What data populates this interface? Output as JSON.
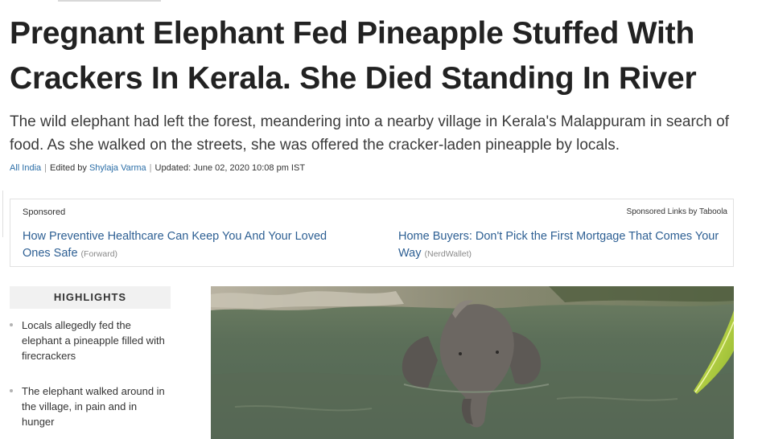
{
  "article": {
    "headline": "Pregnant Elephant Fed Pineapple Stuffed With Crackers In Kerala. She Died Standing In River",
    "summary": "The wild elephant had left the forest, meandering into a nearby village in Kerala's Malappuram in search of food. As she walked on the streets, she was offered the cracker-laden pineapple by locals.",
    "meta": {
      "section": "All India",
      "edited_by_label": "Edited by",
      "editor": "Shylaja Varma",
      "updated": "Updated: June 02, 2020 10:08 pm IST",
      "separator": "|"
    }
  },
  "sponsored": {
    "label": "Sponsored",
    "provider": "Sponsored Links by Taboola",
    "links": [
      {
        "title": "How Preventive Healthcare Can Keep You And Your Loved Ones Safe",
        "source": "(Forward)"
      },
      {
        "title": "Home Buyers: Don't Pick the First Mortgage That Comes Your Way",
        "source": "(NerdWallet)"
      }
    ]
  },
  "highlights": {
    "title": "HIGHLIGHTS",
    "items": [
      "Locals allegedly fed the elephant a pineapple filled with firecrackers",
      "The elephant walked around in the village, in pain and in hunger"
    ]
  },
  "photo": {
    "subject": "elephant-in-river"
  },
  "colors": {
    "link": "#2b6ea7",
    "sponsored_link": "#2d5f93",
    "headline": "#222222",
    "highlight_bg": "#f1f1f1"
  }
}
